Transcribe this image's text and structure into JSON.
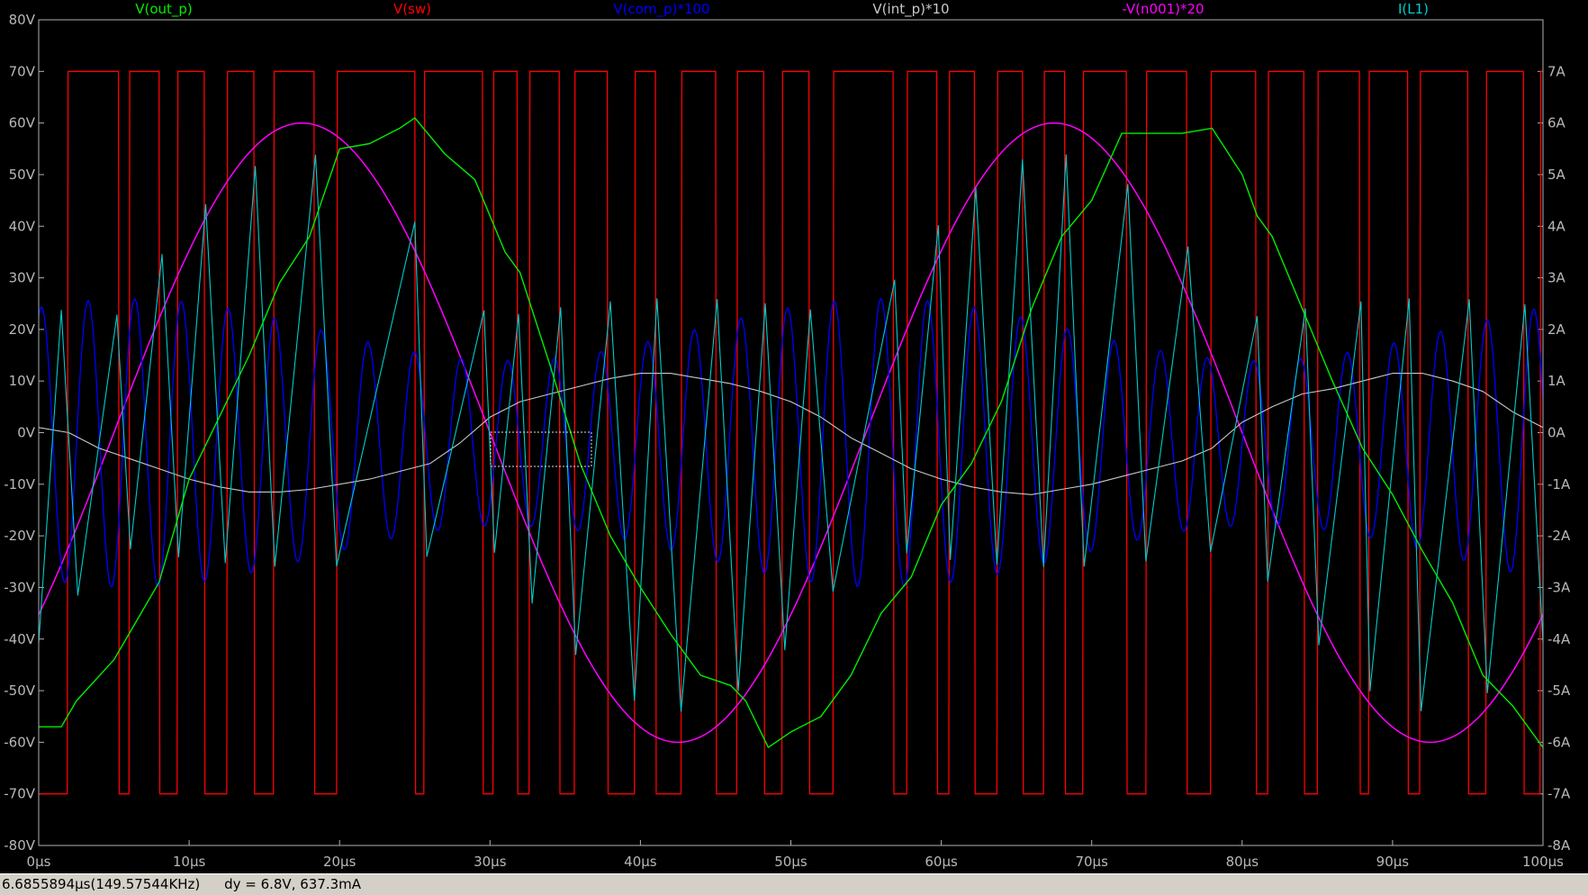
{
  "chart_data": {
    "type": "line",
    "title": "",
    "xlabel": "",
    "ylabel": "",
    "xlim": [
      0,
      100
    ],
    "ylim_left": [
      -80,
      80
    ],
    "ylim_right": [
      -8,
      7
    ],
    "grid": false,
    "legend_placement": "top",
    "x_ticks": [
      "0µs",
      "10µs",
      "20µs",
      "30µs",
      "40µs",
      "50µs",
      "60µs",
      "70µs",
      "80µs",
      "90µs",
      "100µs"
    ],
    "y_ticks_left": [
      "80V",
      "70V",
      "60V",
      "50V",
      "40V",
      "30V",
      "20V",
      "10V",
      "0V",
      "-10V",
      "-20V",
      "-30V",
      "-40V",
      "-50V",
      "-60V",
      "-70V",
      "-80V"
    ],
    "y_ticks_right": [
      "7A",
      "6A",
      "5A",
      "4A",
      "3A",
      "2A",
      "1A",
      "0A",
      "-1A",
      "-2A",
      "-3A",
      "-4A",
      "-5A",
      "-6A",
      "-7A",
      "-8A"
    ],
    "series": [
      {
        "name": "V(out_p)",
        "color": "#00ee00",
        "axis": "left",
        "x": [
          0,
          1.5,
          2.5,
          5,
          6,
          8,
          10,
          12,
          14,
          16,
          18,
          20,
          22,
          24,
          25,
          27,
          29,
          31,
          32,
          34,
          36,
          38,
          40,
          42,
          44,
          46,
          47,
          48.5,
          50,
          52,
          54,
          56,
          58,
          60,
          62,
          64,
          66,
          68,
          70,
          72,
          74,
          76,
          78,
          80,
          81,
          82,
          84,
          86,
          88,
          90,
          92,
          94,
          95,
          96,
          98,
          100
        ],
        "y": [
          -57,
          -57,
          -52,
          -44,
          -39,
          -29,
          -9,
          3,
          15,
          29,
          38,
          55,
          56,
          59,
          61,
          54,
          49,
          35,
          31,
          13,
          -6,
          -20,
          -30,
          -39,
          -47,
          -49,
          -52,
          -61,
          -58,
          -55,
          -47,
          -35,
          -28,
          -14,
          -6,
          6,
          24,
          38,
          45,
          58,
          58,
          58,
          59,
          50,
          42,
          38,
          24,
          10,
          -3,
          -12,
          -23,
          -33,
          -40,
          -47,
          -53,
          -61
        ]
      },
      {
        "name": "V(sw)",
        "color": "#ff0000",
        "axis": "left"
      },
      {
        "name": "V(com_p)*100",
        "color": "#0000ff",
        "axis": "left"
      },
      {
        "name": "V(int_p)*10",
        "color": "#c8c8c8",
        "axis": "left",
        "x": [
          0,
          2,
          4,
          6,
          8,
          10,
          12,
          14,
          16,
          18,
          20,
          22,
          24,
          26,
          28,
          30,
          32,
          34,
          36,
          38,
          40,
          42,
          44,
          46,
          48,
          50,
          52,
          54,
          56,
          58,
          60,
          62,
          64,
          66,
          68,
          70,
          72,
          74,
          76,
          78,
          80,
          82,
          84,
          86,
          88,
          90,
          92,
          94,
          96,
          98,
          100
        ],
        "y": [
          1,
          0,
          -3,
          -5,
          -7,
          -9,
          -10.5,
          -11.5,
          -11.5,
          -11,
          -10,
          -9,
          -7.5,
          -6,
          -2,
          3,
          6,
          7.5,
          9,
          10.5,
          11.5,
          11.5,
          10.5,
          9.5,
          8,
          6,
          3,
          -1,
          -4,
          -7,
          -9,
          -10.5,
          -11.5,
          -12,
          -11,
          -10,
          -8.5,
          -7,
          -5.5,
          -3,
          2,
          5,
          7.5,
          8.5,
          10,
          11.5,
          11.5,
          10,
          8,
          4,
          1
        ]
      },
      {
        "name": "-V(n001)*20",
        "color": "#ff00ff",
        "axis": "left",
        "amplitude": 60,
        "period_us": 50,
        "phase_peak_us": 17.5
      },
      {
        "name": "I(L1)",
        "color": "#00cccc",
        "axis": "right"
      }
    ]
  },
  "status": {
    "dx_text": "6.6855894µs(149.57544KHz)",
    "dy_text": "dy = 6.8V, 637.3mA"
  }
}
